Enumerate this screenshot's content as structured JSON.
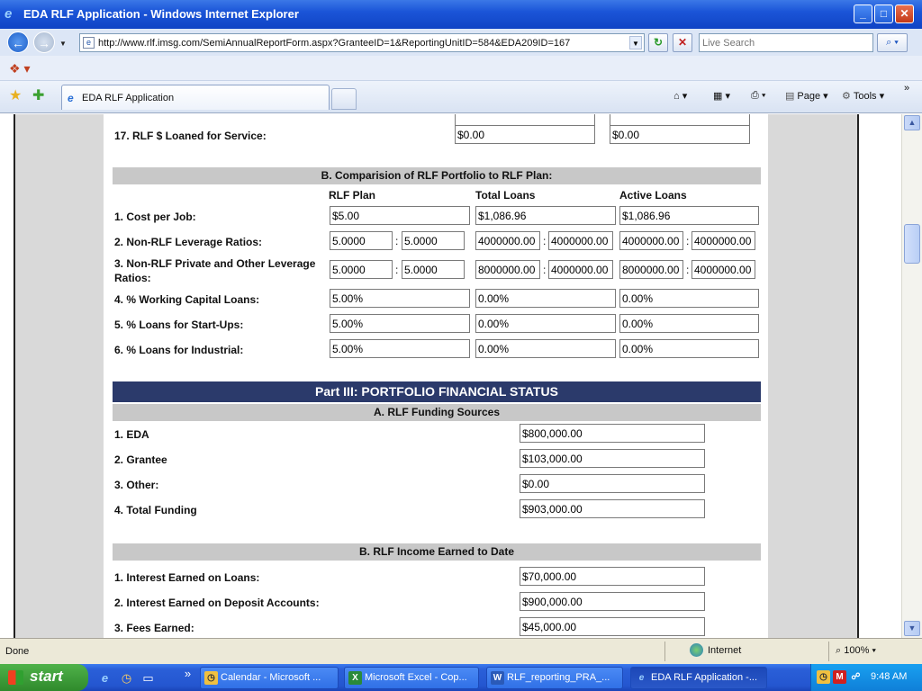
{
  "window": {
    "title": "EDA RLF Application - Windows Internet Explorer"
  },
  "address": {
    "url": "http://www.rlf.imsg.com/SemiAnnualReportForm.aspx?GranteeID=1&ReportingUnitID=584&EDA209ID=167"
  },
  "search": {
    "placeholder": "Live Search"
  },
  "tab": {
    "label": "EDA RLF Application"
  },
  "commands": {
    "page": "Page",
    "tools": "Tools"
  },
  "form": {
    "row17": {
      "label": "17. RLF $ Loaned for Service:",
      "v1": "$0.00",
      "v2": "$0.00"
    },
    "sectionB": {
      "title": "B. Comparision of RLF Portfolio to RLF Plan:",
      "col_plan": "RLF Plan",
      "col_total": "Total Loans",
      "col_active": "Active Loans",
      "r1": {
        "label": "1. Cost per Job:",
        "plan": "$5.00",
        "total": "$1,086.96",
        "active": "$1,086.96"
      },
      "r2": {
        "label": "2. Non-RLF Leverage Ratios:",
        "plan_a": "5.0000",
        "plan_b": "5.0000",
        "total_a": "4000000.00",
        "total_b": "4000000.00",
        "active_a": "4000000.00",
        "active_b": "4000000.00"
      },
      "r3": {
        "label_line1": "3. Non-RLF Private and Other Leverage",
        "label_line2": "Ratios:",
        "plan_a": "5.0000",
        "plan_b": "5.0000",
        "total_a": "8000000.00",
        "total_b": "4000000.00",
        "active_a": "8000000.00",
        "active_b": "4000000.00"
      },
      "r4": {
        "label": "4. % Working Capital Loans:",
        "plan": "5.00%",
        "total": "0.00%",
        "active": "0.00%"
      },
      "r5": {
        "label": "5. % Loans for Start-Ups:",
        "plan": "5.00%",
        "total": "0.00%",
        "active": "0.00%"
      },
      "r6": {
        "label": "6. % Loans for Industrial:",
        "plan": "5.00%",
        "total": "0.00%",
        "active": "0.00%"
      },
      "colon": ":"
    },
    "part3": {
      "title": "Part III: PORTFOLIO FINANCIAL STATUS",
      "sectionA": {
        "title": "A. RLF Funding Sources",
        "eda": {
          "label": "1. EDA",
          "value": "$800,000.00"
        },
        "grantee": {
          "label": "2. Grantee",
          "value": "$103,000.00"
        },
        "other": {
          "label": "3. Other:",
          "value": "$0.00"
        },
        "total": {
          "label": "4. Total Funding",
          "value": "$903,000.00"
        }
      },
      "sectionB": {
        "title": "B. RLF Income Earned to Date",
        "interest_loans": {
          "label": "1. Interest Earned on Loans:",
          "value": "$70,000.00"
        },
        "interest_deposit": {
          "label": "2. Interest Earned on Deposit Accounts:",
          "value": "$900,000.00"
        },
        "fees": {
          "label": "3. Fees Earned:",
          "value": "$45,000.00"
        }
      }
    }
  },
  "status": {
    "text": "Done",
    "zone": "Internet",
    "zoom": "100%"
  },
  "taskbar": {
    "start": "start",
    "tasks": [
      {
        "label": "Calendar - Microsoft ..."
      },
      {
        "label": "Microsoft Excel - Cop..."
      },
      {
        "label": "RLF_reporting_PRA_..."
      },
      {
        "label": "EDA RLF Application -..."
      }
    ],
    "clock": "9:48 AM"
  }
}
